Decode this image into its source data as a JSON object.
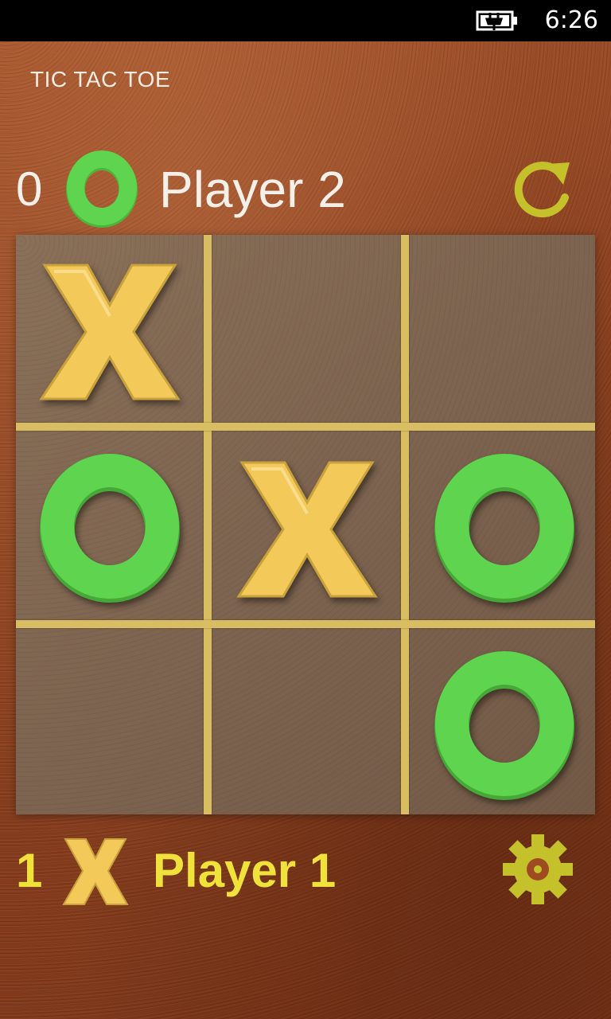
{
  "status_bar": {
    "time": "6:26",
    "battery_icon": "battery-charging-icon"
  },
  "app": {
    "title": "TIC TAC TOE"
  },
  "colors": {
    "x_mark": "#f3c95a",
    "o_mark": "#5fd44f",
    "grid_line": "#d9bd63",
    "player1_text": "#efe23a",
    "player2_text": "#f4efe8"
  },
  "player2": {
    "score": "0",
    "mark": "O",
    "name": "Player 2"
  },
  "player1": {
    "score": "1",
    "mark": "X",
    "name": "Player 1"
  },
  "controls": {
    "restart_icon": "restart-icon",
    "settings_icon": "gear-icon"
  },
  "board": {
    "cells": [
      [
        "X",
        "",
        ""
      ],
      [
        "O",
        "X",
        "O"
      ],
      [
        "",
        "",
        "O"
      ]
    ]
  }
}
